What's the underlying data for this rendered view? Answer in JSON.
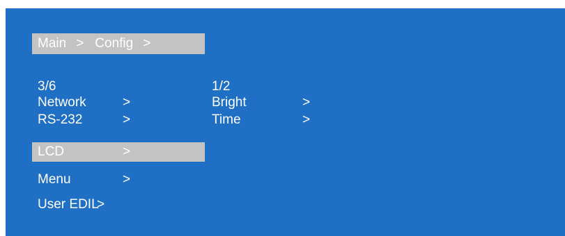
{
  "breadcrumb": {
    "main": "Main",
    "sep1": ">",
    "config": "Config",
    "sep2": ">"
  },
  "left_menu": {
    "counter": "3/6",
    "items": [
      {
        "label": "Network",
        "arrow": ">"
      },
      {
        "label": "RS-232",
        "arrow": ">"
      },
      {
        "label": "LCD",
        "arrow": ">",
        "selected": true
      },
      {
        "label": "Menu",
        "arrow": ">"
      },
      {
        "label": "User EDIL",
        "arrow": ">"
      }
    ]
  },
  "right_menu": {
    "counter": "1/2",
    "items": [
      {
        "label": "Bright",
        "arrow": ">"
      },
      {
        "label": "Time",
        "arrow": ">"
      }
    ]
  },
  "colors": {
    "background": "#1f6fc5",
    "highlight": "#c3c3c3",
    "text": "#ffffff"
  }
}
